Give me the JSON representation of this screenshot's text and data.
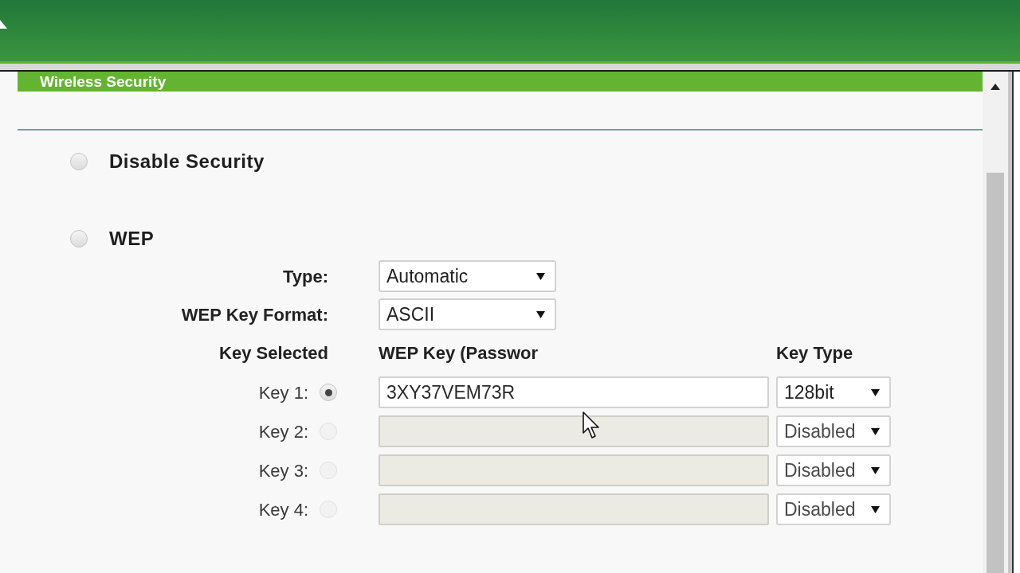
{
  "section_title": "Wireless Security",
  "security_modes": [
    {
      "label": "Disable Security",
      "selected": false
    },
    {
      "label": "WEP",
      "selected": false
    }
  ],
  "wep": {
    "fields": [
      {
        "label": "Type:",
        "value": "Automatic"
      },
      {
        "label": "WEP Key Format:",
        "value": "ASCII"
      }
    ],
    "key_table": {
      "columns": [
        "Key Selected",
        "WEP Key (Passwor",
        "Key Type"
      ],
      "rows": [
        {
          "label": "Key 1:",
          "selected": true,
          "disabled": false,
          "value": "3XY37VEM73R",
          "key_type": "128bit"
        },
        {
          "label": "Key 2:",
          "selected": false,
          "disabled": true,
          "key_type": "Disabled"
        },
        {
          "label": "Key 3:",
          "selected": false,
          "disabled": true,
          "key_type": "Disabled"
        },
        {
          "label": "Key 4:",
          "selected": false,
          "disabled": true,
          "key_type": "Disabled"
        }
      ]
    }
  }
}
